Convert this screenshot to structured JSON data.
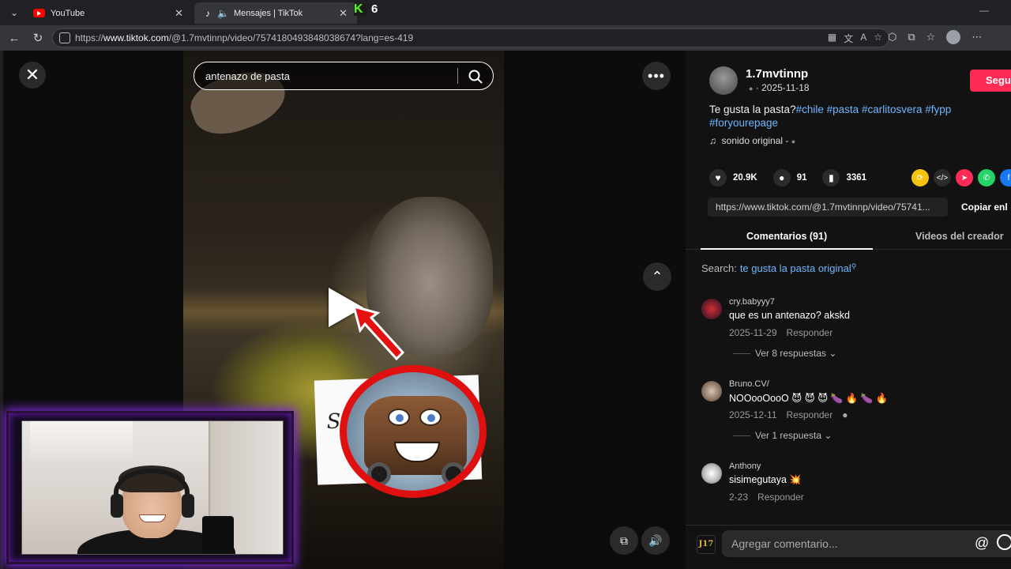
{
  "browser": {
    "tabs": [
      {
        "title": "YouTube",
        "icon": "youtube-icon"
      },
      {
        "title": "Mensajes | TikTok",
        "icon": "tiktok-icon",
        "audio": "speaker-icon"
      }
    ],
    "overlay_badge": "6",
    "url_prefix": "https://",
    "url_host": "www.tiktok.com",
    "url_path": "/@1.7mvtinnp/video/7574180493848038674?lang=es-419"
  },
  "video": {
    "search_text": "antenazo de pasta",
    "sticker_text": "Su"
  },
  "post": {
    "author": "1.7mvtinnp",
    "meta": "· 2025-11-18",
    "caption_text": "Te gusta la pasta?",
    "hashtags": [
      "#chile",
      "#pasta",
      "#carlitosvera",
      "#fypp",
      "#foryourepage"
    ],
    "sound": "sonido original -",
    "follow_label": "Segu",
    "likes": "20.9K",
    "comments": "91",
    "saves": "3361",
    "share_link": "https://www.tiktok.com/@1.7mvtinnp/video/75741...",
    "copy_label": "Copiar enl"
  },
  "panel_tabs": {
    "comments": "Comentarios (91)",
    "creator_videos": "Videos del creador"
  },
  "search_suggestion": {
    "label": "Search:",
    "query": "te gusta la pasta original"
  },
  "comments": [
    {
      "user": "cry.babyyy7",
      "text": "que es un antenazo? akskd",
      "date": "2025-11-29",
      "reply": "Responder",
      "replies": "Ver 8 respuestas"
    },
    {
      "user": "Bruno.CV/",
      "text": "NOOooOooO 😈 😈 😈 🍆 🔥 🍆 🔥",
      "date": "2025-12-11",
      "reply": "Responder",
      "replies": "Ver 1 respuesta"
    },
    {
      "user": "Anthony",
      "text": "sisimegutaya 💥",
      "date": "2-23",
      "reply": "Responder"
    }
  ],
  "composer": {
    "placeholder": "Agregar comentario...",
    "avatar_text": "J17"
  },
  "colors": {
    "accent": "#fe2c55",
    "hashtag": "#6fb6ff",
    "background": "#121212"
  }
}
